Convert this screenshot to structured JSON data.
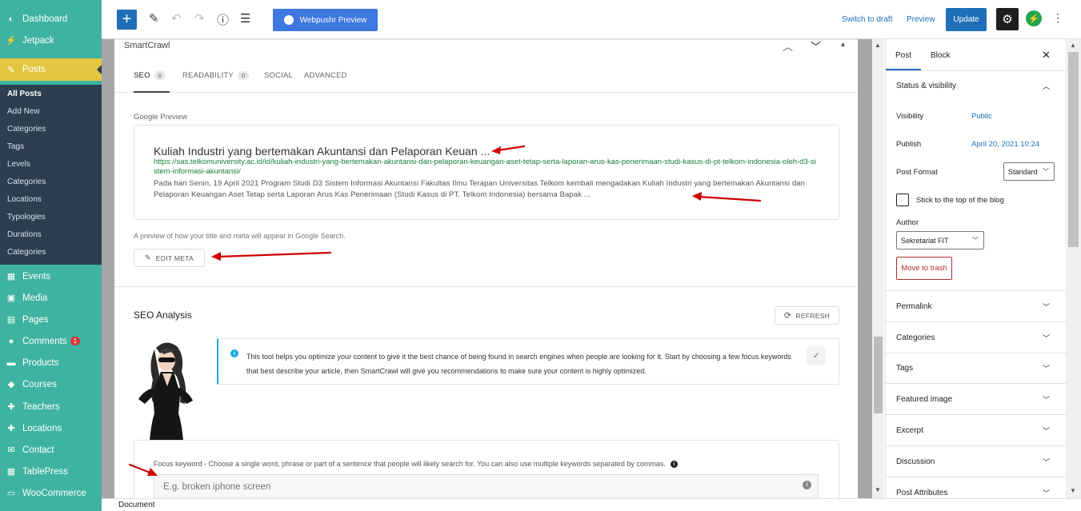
{
  "admin_menu": {
    "items": [
      {
        "label": "Dashboard",
        "icon": "dashboard-icon",
        "glyph": "◐"
      },
      {
        "label": "Jetpack",
        "icon": "jetpack-icon",
        "glyph": "⚡"
      },
      {
        "label": "Posts",
        "icon": "pin-icon",
        "glyph": "✎"
      },
      {
        "label": "Events",
        "icon": "calendar-icon",
        "glyph": "▦"
      },
      {
        "label": "Media",
        "icon": "media-icon",
        "glyph": "▣"
      },
      {
        "label": "Pages",
        "icon": "page-icon",
        "glyph": "▤"
      },
      {
        "label": "Comments",
        "icon": "comment-icon",
        "glyph": "●",
        "badge": "1"
      },
      {
        "label": "Products",
        "icon": "archive-icon",
        "glyph": "▬"
      },
      {
        "label": "Courses",
        "icon": "courses-icon",
        "glyph": "◆"
      },
      {
        "label": "Teachers",
        "icon": "teacher-icon",
        "glyph": "✚"
      },
      {
        "label": "Locations",
        "icon": "location-icon",
        "glyph": "✚"
      },
      {
        "label": "Contact",
        "icon": "mail-icon",
        "glyph": "✉"
      },
      {
        "label": "TablePress",
        "icon": "table-icon",
        "glyph": "▦"
      },
      {
        "label": "WooCommerce",
        "icon": "woo-icon",
        "glyph": "▭"
      }
    ],
    "submenu": [
      "All Posts",
      "Add New",
      "Categories",
      "Tags",
      "Levels",
      "Categories",
      "Locations",
      "Typologies",
      "Durations",
      "Categories"
    ]
  },
  "toolbar": {
    "add_glyph": "+",
    "edit_glyph": "✎",
    "undo_glyph": "↶",
    "redo_glyph": "↷",
    "info_glyph": "ⓘ",
    "list_glyph": "☰",
    "webpushr_label": "Webpushr Preview",
    "switch_to_draft": "Switch to draft",
    "preview": "Preview",
    "update": "Update",
    "settings_glyph": "⚙",
    "jetpack_glyph": "⚡",
    "more_glyph": "⋮"
  },
  "smartcrawl": {
    "title": "SmartCrawl",
    "ctrl_up": "︿",
    "ctrl_down": "﹀",
    "ctrl_collapse": "▴",
    "tabs": [
      {
        "label": "SEO",
        "count": "0"
      },
      {
        "label": "READABILITY",
        "count": "0"
      },
      {
        "label": "SOCIAL"
      },
      {
        "label": "ADVANCED"
      }
    ],
    "google_preview_label": "Google Preview",
    "preview_title": "Kuliah Industri yang bertemakan Akuntansi dan Pelaporan Keuan ...",
    "preview_url": "https://sas.telkomuniversity.ac.id/id/kuliah-industri-yang-bertemakan-akuntansi-dan-pelaporan-keuangan-aset-tetap-serta-laporan-arus-kas-penerimaan-studi-kasus-di-pt-telkom-indonesia-oleh-d3-sistem-informasi-akuntansi/",
    "preview_desc": "Pada hari Senin, 19 April 2021 Program Studi D3 Sistem Informasi Akuntansi Fakultas Ilmu Terapan Universitas Telkom kembali mengadakan Kuliah Industri yang bertemakan Akuntansi dan Pelaporan Keuangan Aset Tetap serta Laporan Arus Kas Penerimaan (Studi Kasus di PT. Telkom Indonesia) bersama Bapak ...",
    "preview_note": "A preview of how your title and meta will appear in Google Search.",
    "edit_meta": "EDIT META",
    "seo_analysis_title": "SEO Analysis",
    "refresh": "REFRESH",
    "info_text": "This tool helps you optimize your content to give it the best chance of being found in search engines when people are looking for it. Start by choosing a few focus keywords that best describe your article, then SmartCrawl will give you recommendations to make sure your content is highly optimized.",
    "focus_label": "Focus keyword - Choose a single word, phrase or part of a sentence that people will likely search for. You can also use multiple keywords separated by commas.",
    "focus_placeholder": "E.g. broken iphone screen"
  },
  "sidebar": {
    "tabs": [
      "Post",
      "Block"
    ],
    "close_glyph": "✕",
    "status_title": "Status & visibility",
    "visibility_label": "Visibility",
    "visibility_value": "Public",
    "publish_label": "Publish",
    "publish_value": "April 20, 2021 10:24",
    "post_format_label": "Post Format",
    "post_format_value": "Standard",
    "sticky_label": "Stick to the top of the blog",
    "author_label": "Author",
    "author_value": "Sekretariat FIT",
    "trash": "Move to trash",
    "sections": [
      "Permalink",
      "Categories",
      "Tags",
      "Featured image",
      "Excerpt",
      "Discussion",
      "Post Attributes"
    ]
  },
  "statusbar": {
    "label": "Document"
  },
  "colors": {
    "admin_menu_bg": "#3fb3a2",
    "active_menu_bg": "#e5c640",
    "submenu_bg": "#2c3e50",
    "primary": "#1e6fb8",
    "url_green": "#1a7f37",
    "annotation_red": "#d00000"
  }
}
